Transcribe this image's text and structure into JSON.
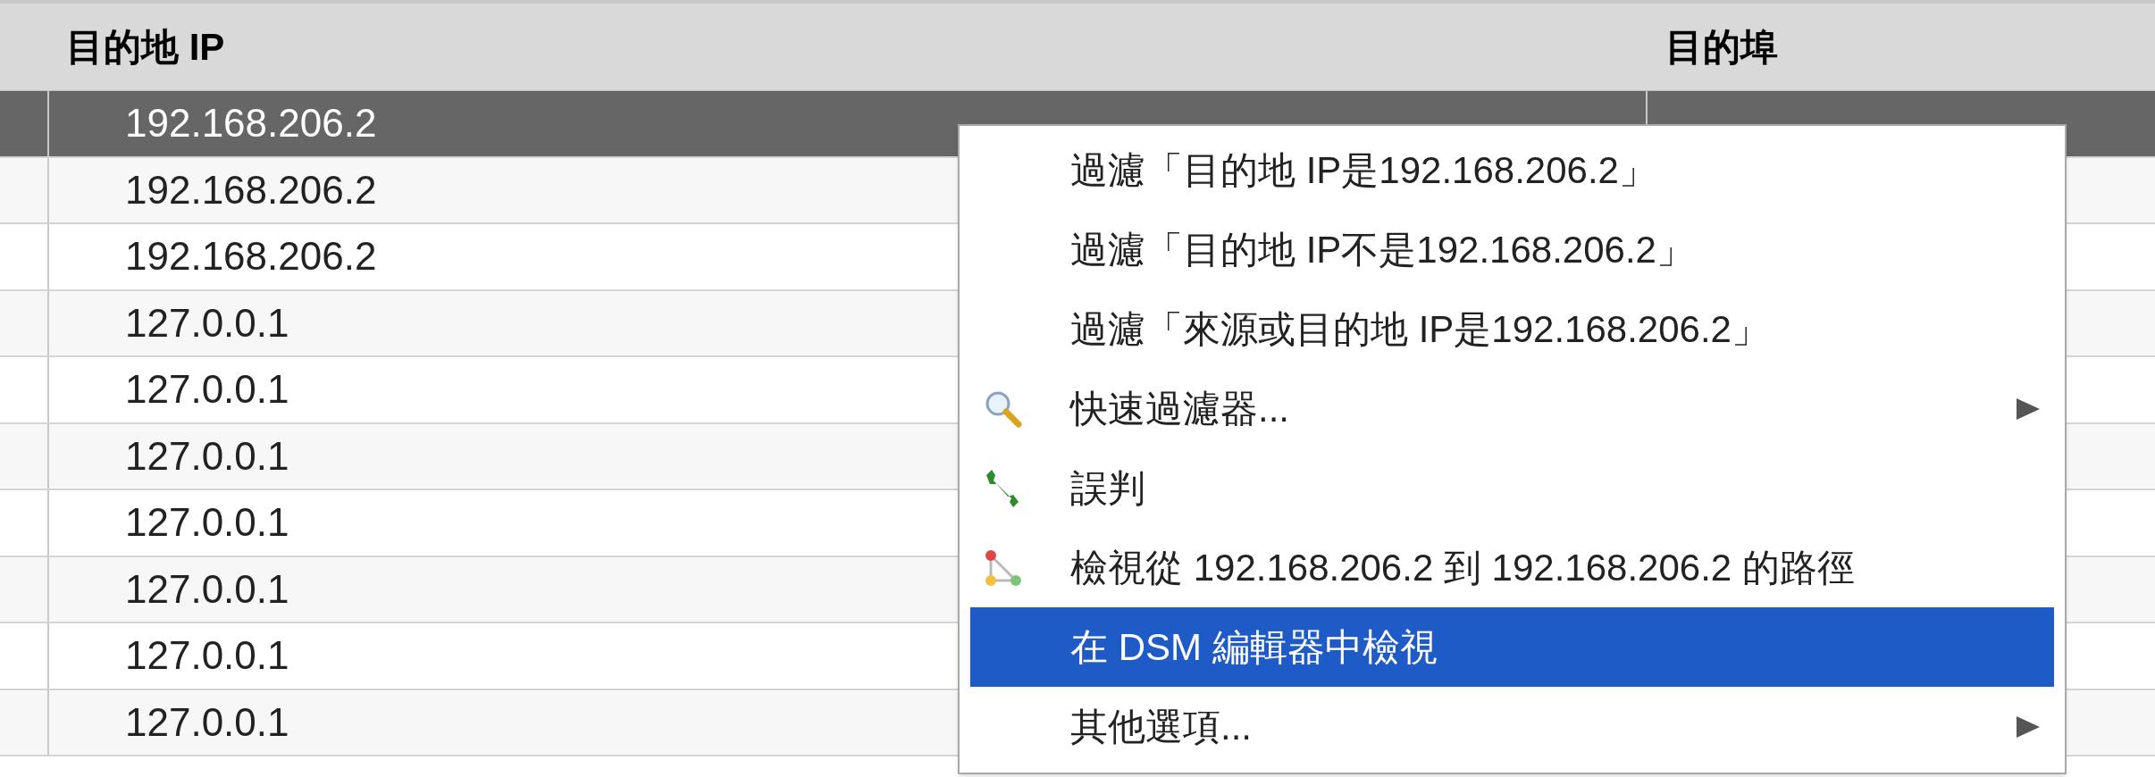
{
  "table": {
    "columns": [
      "目的地 IP",
      "目的埠"
    ],
    "rows": [
      {
        "dest_ip": "192.168.206.2",
        "selected": true
      },
      {
        "dest_ip": "192.168.206.2",
        "selected": false
      },
      {
        "dest_ip": "192.168.206.2",
        "selected": false
      },
      {
        "dest_ip": "127.0.0.1",
        "selected": false
      },
      {
        "dest_ip": "127.0.0.1",
        "selected": false
      },
      {
        "dest_ip": "127.0.0.1",
        "selected": false
      },
      {
        "dest_ip": "127.0.0.1",
        "selected": false
      },
      {
        "dest_ip": "127.0.0.1",
        "selected": false
      },
      {
        "dest_ip": "127.0.0.1",
        "selected": false
      },
      {
        "dest_ip": "127.0.0.1",
        "selected": false
      }
    ]
  },
  "context_menu": {
    "items": [
      {
        "label": "過濾「目的地 IP是192.168.206.2」",
        "kind": "plain",
        "submenu": false,
        "selected": false
      },
      {
        "label": "過濾「目的地 IP不是192.168.206.2」",
        "kind": "plain",
        "submenu": false,
        "selected": false
      },
      {
        "label": "過濾「來源或目的地 IP是192.168.206.2」",
        "kind": "plain",
        "submenu": false,
        "selected": false
      },
      {
        "label": "快速過濾器...",
        "kind": "search",
        "submenu": true,
        "selected": false
      },
      {
        "label": "誤判",
        "kind": "tool",
        "submenu": false,
        "selected": false
      },
      {
        "label": "檢視從 192.168.206.2 到 192.168.206.2 的路徑",
        "kind": "route",
        "submenu": false,
        "selected": false
      },
      {
        "label": "在 DSM 編輯器中檢視",
        "kind": "plain",
        "submenu": false,
        "selected": true
      },
      {
        "label": "其他選項...",
        "kind": "plain",
        "submenu": true,
        "selected": false
      }
    ]
  }
}
